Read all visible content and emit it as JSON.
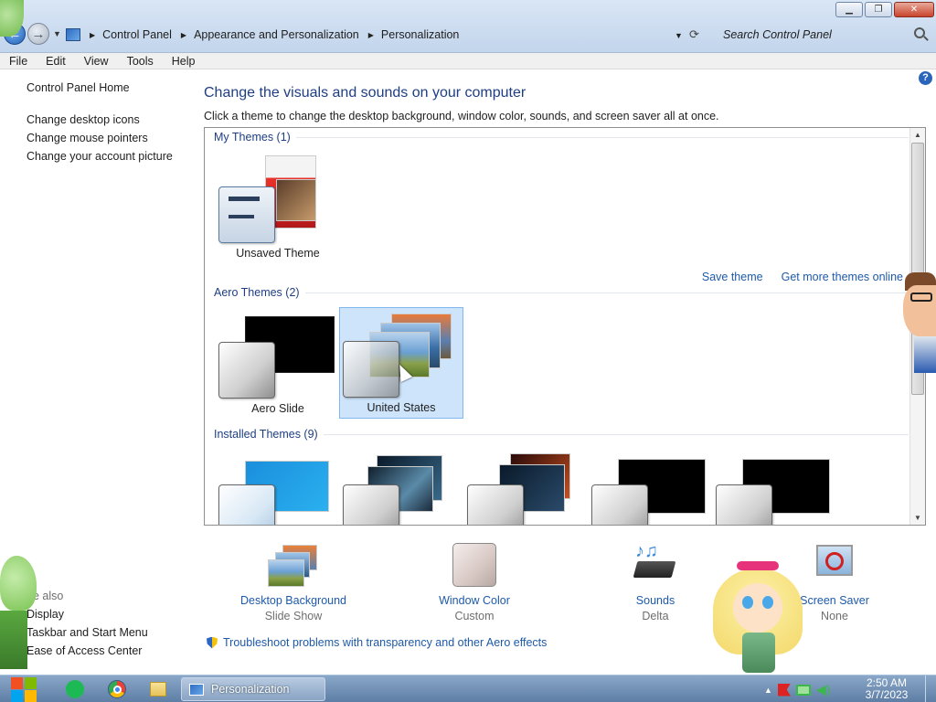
{
  "window": {
    "title_buttons": {
      "minimize": "▁",
      "maximize": "❐",
      "close": "✕"
    }
  },
  "nav": {
    "breadcrumbs": [
      "Control Panel",
      "Appearance and Personalization",
      "Personalization"
    ],
    "search_placeholder": "Search Control Panel"
  },
  "menu": [
    "File",
    "Edit",
    "View",
    "Tools",
    "Help"
  ],
  "left": {
    "home": "Control Panel Home",
    "links": [
      "Change desktop icons",
      "Change mouse pointers",
      "Change your account picture"
    ],
    "see_also_title": "ee also",
    "see_also": [
      "Display",
      "Taskbar and Start Menu",
      "Ease of Access Center"
    ]
  },
  "main": {
    "title": "Change the visuals and sounds on your computer",
    "description": "Click a theme to change the desktop background, window color, sounds, and screen saver all at once.",
    "groups": {
      "my": "My Themes (1)",
      "aero": "Aero Themes (2)",
      "installed": "Installed Themes (9)"
    },
    "my_themes": [
      {
        "label": "Unsaved Theme"
      }
    ],
    "aero_themes": [
      {
        "label": "Aero Slide"
      },
      {
        "label": "United States",
        "selected": true
      }
    ],
    "save_theme": "Save theme",
    "get_more": "Get more themes online"
  },
  "settings": [
    {
      "name": "Desktop Background",
      "value": "Slide Show"
    },
    {
      "name": "Window Color",
      "value": "Custom"
    },
    {
      "name": "Sounds",
      "value": "Delta"
    },
    {
      "name": "Screen Saver",
      "value": "None"
    }
  ],
  "troubleshoot": "Troubleshoot problems with transparency and other Aero effects",
  "taskbar": {
    "task_label": "Personalization",
    "time": "2:50 AM",
    "date": "3/7/2023"
  },
  "colors": {
    "link": "#1e5aa8",
    "heading": "#1e3e84",
    "selection": "#cde4fb"
  }
}
